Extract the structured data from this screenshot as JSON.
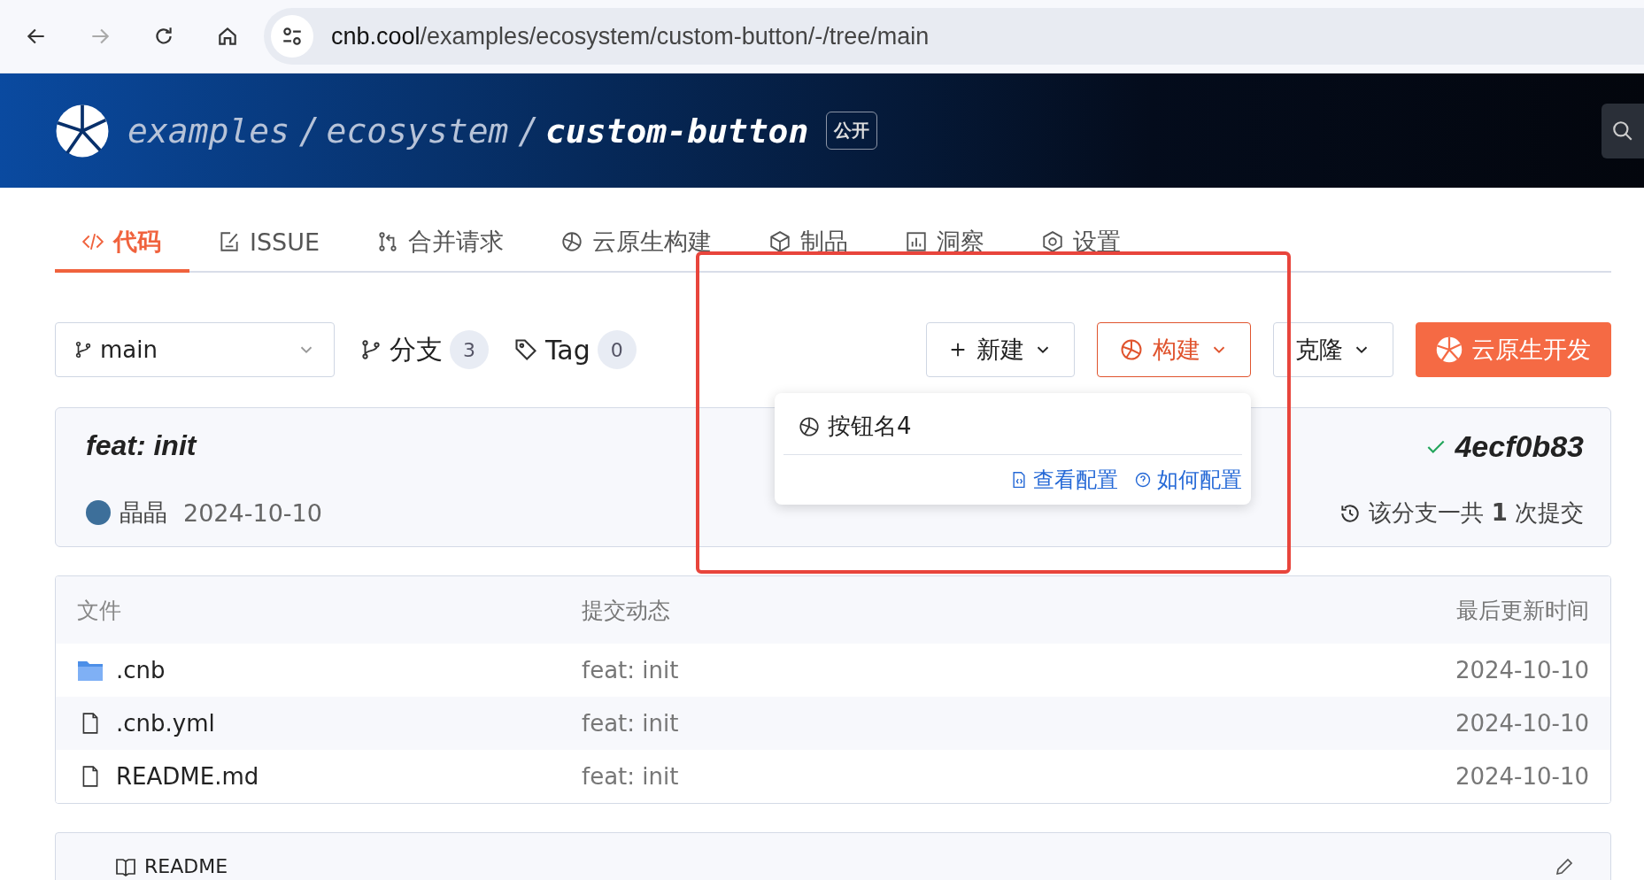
{
  "browser": {
    "url_host": "cnb.cool",
    "url_path": "/examples/ecosystem/custom-button/-/tree/main"
  },
  "header": {
    "breadcrumb": [
      "examples",
      "ecosystem",
      "custom-button"
    ],
    "separator": "/",
    "badge": "公开"
  },
  "tabs": [
    {
      "label": "代码",
      "selected": true
    },
    {
      "label": "ISSUE",
      "selected": false
    },
    {
      "label": "合并请求",
      "selected": false
    },
    {
      "label": "云原生构建",
      "selected": false
    },
    {
      "label": "制品",
      "selected": false
    },
    {
      "label": "洞察",
      "selected": false
    },
    {
      "label": "设置",
      "selected": false
    }
  ],
  "toolbar": {
    "branch": "main",
    "branches_label": "分支",
    "branches_count": "3",
    "tags_label": "Tag",
    "tags_count": "0",
    "buttons": [
      {
        "label": "新建",
        "kind": "new",
        "expanded": false
      },
      {
        "label": "构建",
        "kind": "build",
        "expanded": true
      },
      {
        "label": "克隆",
        "kind": "clone",
        "expanded": false
      },
      {
        "label": "云原生开发",
        "kind": "primary",
        "expanded": false
      }
    ]
  },
  "build_menu": {
    "items": [
      "按钮名4"
    ],
    "links": [
      "查看配置",
      "如何配置"
    ]
  },
  "commit": {
    "message": "feat: init",
    "author": "晶晶",
    "date": "2024-10-10",
    "hash": "4ecf0b83",
    "passed": true,
    "summary": "该分支一共 **1** 次提交"
  },
  "files": {
    "columns": [
      "文件",
      "提交动态",
      "最后更新时间"
    ],
    "rows": [
      {
        "name": ".cnb",
        "kind": "folder",
        "commit": "feat: init",
        "date": "2024-10-10"
      },
      {
        "name": ".cnb.yml",
        "kind": "file",
        "commit": "feat: init",
        "date": "2024-10-10"
      },
      {
        "name": "README.md",
        "kind": "file",
        "commit": "feat: init",
        "date": "2024-10-10"
      }
    ]
  },
  "readme": {
    "title": "README"
  }
}
